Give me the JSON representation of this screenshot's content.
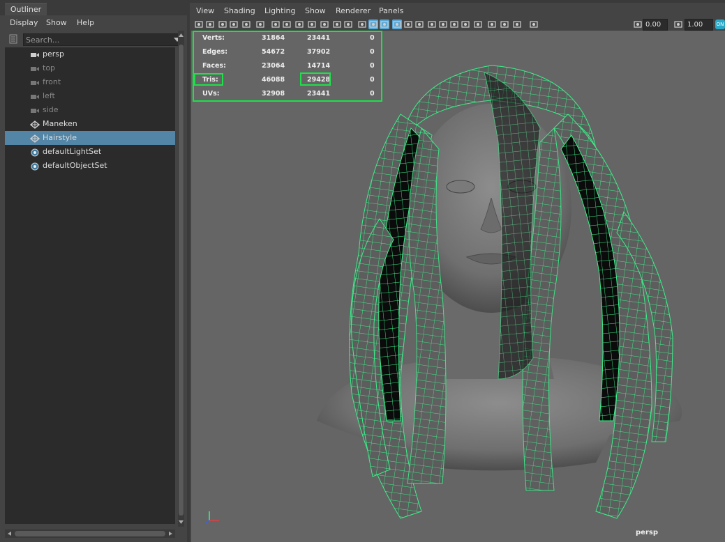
{
  "outliner": {
    "tab": "Outliner",
    "menu": [
      "Display",
      "Show",
      "Help"
    ],
    "search_placeholder": "Search...",
    "items": [
      {
        "label": "persp",
        "icon": "camera-icon"
      },
      {
        "label": "top",
        "icon": "camera-icon"
      },
      {
        "label": "front",
        "icon": "camera-icon"
      },
      {
        "label": "left",
        "icon": "camera-icon"
      },
      {
        "label": "side",
        "icon": "camera-icon"
      },
      {
        "label": "Maneken",
        "icon": "mesh-icon"
      },
      {
        "label": "Hairstyle",
        "icon": "mesh-icon"
      },
      {
        "label": "defaultLightSet",
        "icon": "set-icon"
      },
      {
        "label": "defaultObjectSet",
        "icon": "set-icon"
      }
    ],
    "selected_item": "Hairstyle"
  },
  "viewport": {
    "menu": [
      "View",
      "Shading",
      "Lighting",
      "Show",
      "Renderer",
      "Panels"
    ],
    "toolbar": {
      "field1": "0.00",
      "field2": "1.00",
      "on_badge": "ON"
    },
    "hud": [
      {
        "label": "Verts:",
        "v1": "31864",
        "v2": "23441",
        "v3": "0"
      },
      {
        "label": "Edges:",
        "v1": "54672",
        "v2": "37902",
        "v3": "0"
      },
      {
        "label": "Faces:",
        "v1": "23064",
        "v2": "14714",
        "v3": "0"
      },
      {
        "label": "Tris:",
        "v1": "46088",
        "v2": "29428",
        "v3": "0"
      },
      {
        "label": "UVs:",
        "v1": "32908",
        "v2": "23441",
        "v3": "0"
      }
    ],
    "camera_label": "persp",
    "highlight_color": "#1fe04a",
    "wire_color": "#3bf08a"
  }
}
